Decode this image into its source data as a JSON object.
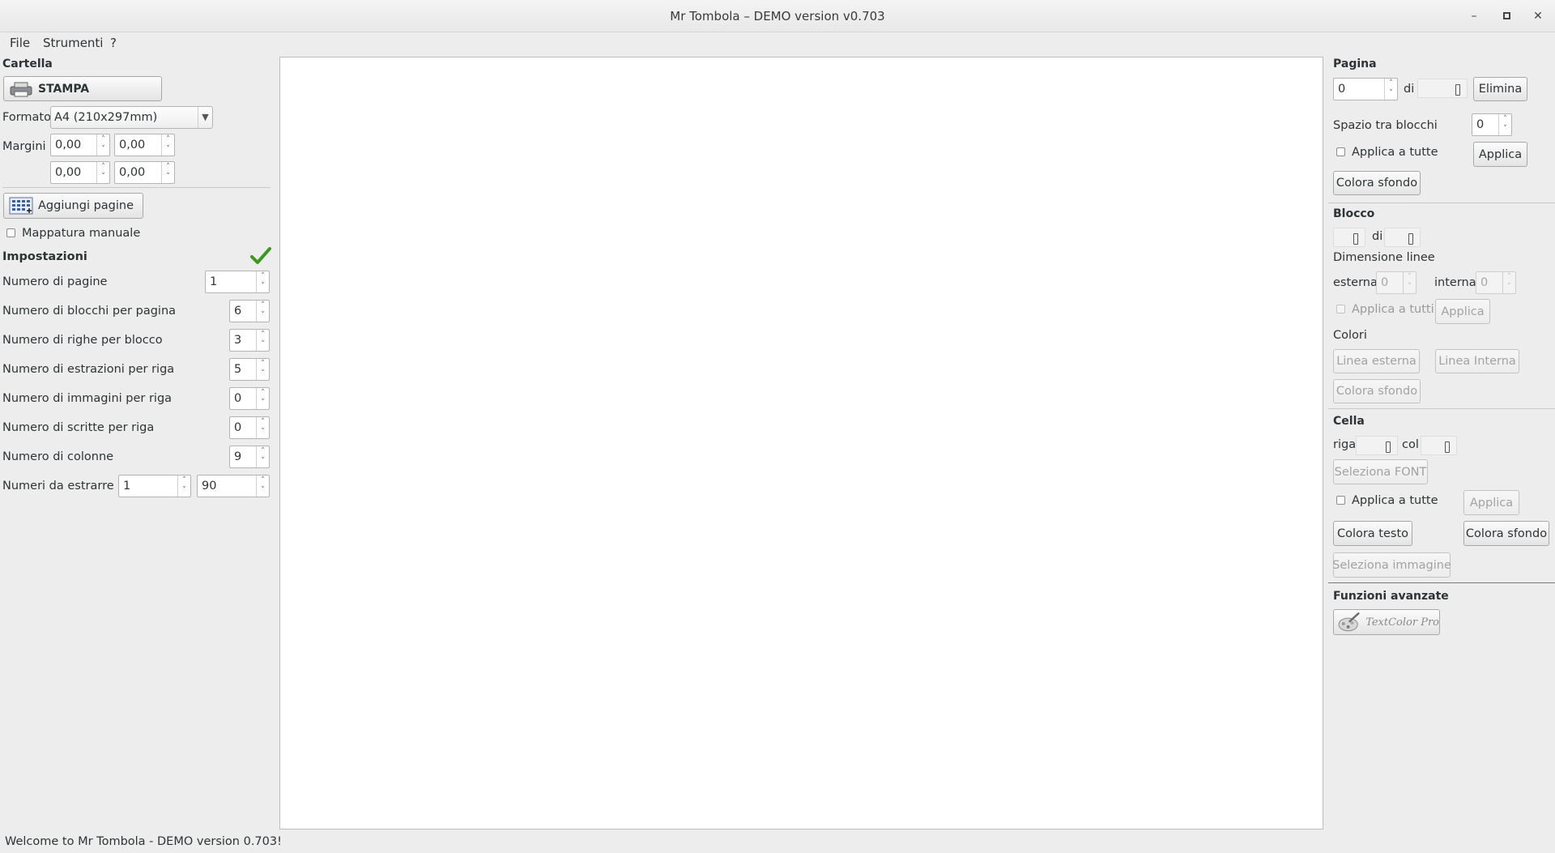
{
  "window": {
    "title": "Mr Tombola – DEMO version v0.703",
    "controls": {
      "minimize": "–",
      "maximize": "▫",
      "close": "✕"
    }
  },
  "menu": {
    "file": "File",
    "tools": "Strumenti",
    "help": "?"
  },
  "left": {
    "cartella": {
      "title": "Cartella",
      "print_label": "STAMPA",
      "format_label": "Formato",
      "format_value": "A4 (210x297mm)",
      "margins_label": "Margini",
      "margins": [
        "0,00",
        "0,00",
        "0,00",
        "0,00"
      ]
    },
    "add_pages_label": "Aggiungi pagine",
    "manual_mapping_label": "Mappatura manuale",
    "settings": {
      "title": "Impostazioni",
      "pages_label": "Numero di pagine",
      "pages_value": "1",
      "blocks_label": "Numero di blocchi per pagina",
      "blocks_value": "6",
      "rows_label": "Numero di righe per blocco",
      "rows_value": "3",
      "draws_label": "Numero di estrazioni per riga",
      "draws_value": "5",
      "images_label": "Numero di immagini per riga",
      "images_value": "0",
      "texts_label": "Numero di scritte per riga",
      "texts_value": "0",
      "columns_label": "Numero di colonne",
      "columns_value": "9",
      "range_label": "Numeri da estrarre",
      "range_from": "1",
      "range_to": "90"
    }
  },
  "right": {
    "pagina": {
      "title": "Pagina",
      "page_value": "0",
      "of_label": "di",
      "delete_label": "Elimina",
      "spacing_label": "Spazio tra blocchi",
      "spacing_value": "0",
      "apply_all_label": "Applica a tutte",
      "apply_label": "Applica",
      "bg_color_label": "Colora sfondo"
    },
    "blocco": {
      "title": "Blocco",
      "of_label": "di",
      "line_size_label": "Dimensione linee",
      "outer_label": "esterna",
      "outer_value": "0",
      "inner_label": "interna",
      "inner_value": "0",
      "apply_all_label": "Applica a tutti",
      "apply_label": "Applica",
      "colors_label": "Colori",
      "outer_line_label": "Linea esterna",
      "inner_line_label": "Linea Interna",
      "bg_color_label": "Colora sfondo"
    },
    "cella": {
      "title": "Cella",
      "row_label": "riga",
      "col_label": "col",
      "font_label": "Seleziona FONT",
      "apply_all_label": "Applica a tutte",
      "apply_label": "Applica",
      "text_color_label": "Colora testo",
      "bg_color_label": "Colora sfondo",
      "image_label": "Seleziona immagine"
    },
    "advanced": {
      "title": "Funzioni avanzate",
      "textcolor_label": "TextColor Pro"
    }
  },
  "status": {
    "text": "Welcome to Mr Tombola - DEMO version 0.703!"
  }
}
